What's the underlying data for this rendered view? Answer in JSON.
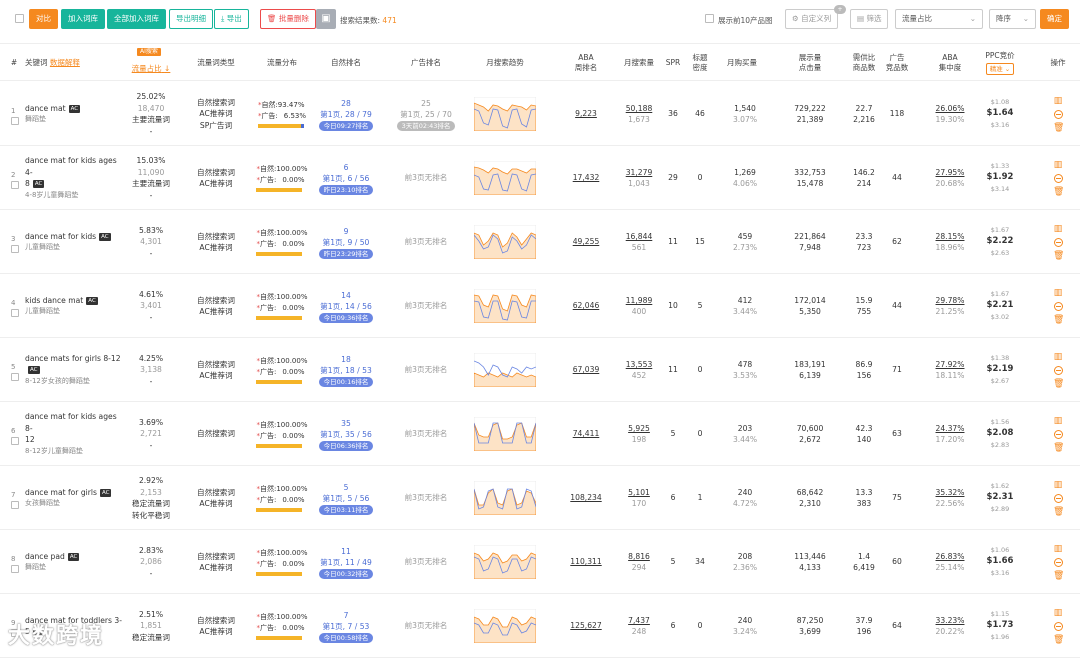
{
  "toolbar": {
    "compare": "对比",
    "add": "加入词库",
    "add_all": "全部加入词库",
    "export_detail": "导出明细",
    "export": "导出",
    "batch_delete": "批量删除",
    "result_label": "搜索结果数:",
    "result_count": "471",
    "show_top10": "展示前10产品图",
    "custom_cols": "自定义列",
    "custom_badge": "+",
    "filter": "筛选",
    "sort_field": "流量占比",
    "sort_order": "降序",
    "confirm": "确定"
  },
  "header": {
    "idx": "#",
    "keyword": "关键词",
    "translate": "数据解释",
    "share_tag": "AI搜索",
    "share": "流量占比",
    "type": "流量词类型",
    "dist": "流量分布",
    "natural": "自然排名",
    "ad": "广告排名",
    "trend": "月搜索趋势",
    "aba_l1": "ABA",
    "aba_l2": "周排名",
    "monthly": "月搜索量",
    "spr": "SPR",
    "title_l1": "标题",
    "title_l2": "密度",
    "buy": "月购买量",
    "disp_l1": "展示量",
    "disp_l2": "点击量",
    "ratio_l1": "需供比",
    "ratio_l2": "商品数",
    "adc_l1": "广告",
    "adc_l2": "竞品数",
    "conc_l1": "ABA",
    "conc_l2": "集中度",
    "ppc": "PPC竞价",
    "ppc_mode": "精准",
    "ops": "操作"
  },
  "labels": {
    "natural_prefix": "自然:",
    "ad_prefix": "广告:"
  },
  "rows": [
    {
      "idx": "1",
      "kw": "dance mat",
      "kw2": "",
      "ac": "AC",
      "cn": "舞蹈垫",
      "share": "25.02%",
      "share2": "18,470",
      "share3": "主要流量词",
      "share4": "-",
      "types": [
        "自然搜索词",
        "AC推荐词",
        "SP广告词"
      ],
      "nat_pct": "93.47%",
      "ad_pct": "6.53%",
      "ad_frac": 0.07,
      "nat_rank": "28",
      "nat_page": "第1页, 28 / 79",
      "nat_pill": "今日09:27排名",
      "ad_rank": "25",
      "ad_page": "第1页, 25 / 70",
      "ad_pill": "3天前02:43排名",
      "ad_none": "",
      "trend": [
        22,
        20,
        8,
        6,
        22,
        21,
        5,
        3,
        21,
        22,
        7,
        4,
        21,
        22
      ],
      "trend2": [
        28,
        26,
        24,
        20,
        26,
        25,
        22,
        20,
        26,
        25,
        24,
        21,
        26,
        25
      ],
      "aba": "9,223",
      "monthly": "50,188",
      "monthly2": "1,673",
      "spr": "36",
      "title": "46",
      "buy": "1,540",
      "buy2": "3.07%",
      "disp": "729,222",
      "click": "21,389",
      "ratio": "22.7",
      "goods": "2,216",
      "adc": "118",
      "conc": "26.06%",
      "conc2": "19.30%",
      "ppc_top": "$1.08",
      "ppc": "$1.64",
      "ppc_bot": "$3.16"
    },
    {
      "idx": "2",
      "kw": "dance mat for kids ages 4-",
      "kw2": "8",
      "ac": "AC",
      "cn": "4-8岁儿童舞蹈垫",
      "share": "15.03%",
      "share2": "11,090",
      "share3": "主要流量词",
      "share4": "-",
      "types": [
        "自然搜索词",
        "AC推荐词"
      ],
      "nat_pct": "100.00%",
      "ad_pct": "0.00%",
      "ad_frac": 0,
      "nat_rank": "6",
      "nat_page": "第1页, 6 / 56",
      "nat_pill": "昨日23:10排名",
      "ad_rank": "",
      "ad_page": "",
      "ad_pill": "",
      "ad_none": "前3页无排名",
      "trend": [
        20,
        18,
        6,
        5,
        20,
        21,
        5,
        4,
        21,
        20,
        6,
        4,
        20,
        21
      ],
      "trend2": [
        28,
        27,
        25,
        22,
        27,
        26,
        23,
        21,
        26,
        26,
        24,
        22,
        26,
        26
      ],
      "aba": "17,432",
      "monthly": "31,279",
      "monthly2": "1,043",
      "spr": "29",
      "title": "0",
      "buy": "1,269",
      "buy2": "4.06%",
      "disp": "332,753",
      "click": "15,478",
      "ratio": "146.2",
      "goods": "214",
      "adc": "44",
      "conc": "27.95%",
      "conc2": "20.68%",
      "ppc_top": "$1.33",
      "ppc": "$1.92",
      "ppc_bot": "$3.14"
    },
    {
      "idx": "3",
      "kw": "dance mat for kids",
      "kw2": "",
      "ac": "AC",
      "cn": "儿童舞蹈垫",
      "share": "5.83%",
      "share2": "4,301",
      "share3": "-",
      "share4": "",
      "types": [
        "自然搜索词",
        "AC推荐词"
      ],
      "nat_pct": "100.00%",
      "ad_pct": "0.00%",
      "ad_frac": 0,
      "nat_rank": "9",
      "nat_page": "第1页, 9 / 50",
      "nat_pill": "昨日23:29排名",
      "ad_rank": "",
      "ad_page": "",
      "ad_pill": "",
      "ad_none": "前3页无排名",
      "trend": [
        24,
        18,
        10,
        12,
        24,
        20,
        6,
        8,
        22,
        18,
        10,
        14,
        24,
        20
      ],
      "trend2": [
        26,
        24,
        14,
        18,
        26,
        24,
        12,
        16,
        26,
        22,
        14,
        20,
        26,
        24
      ],
      "aba": "49,255",
      "monthly": "16,844",
      "monthly2": "561",
      "spr": "11",
      "title": "15",
      "buy": "459",
      "buy2": "2.73%",
      "disp": "221,864",
      "click": "7,948",
      "ratio": "23.3",
      "goods": "723",
      "adc": "62",
      "conc": "28.15%",
      "conc2": "18.96%",
      "ppc_top": "$1.67",
      "ppc": "$2.22",
      "ppc_bot": "$2.63"
    },
    {
      "idx": "4",
      "kw": "kids dance mat",
      "kw2": "",
      "ac": "AC",
      "cn": "儿童舞蹈垫",
      "share": "4.61%",
      "share2": "3,401",
      "share3": "-",
      "share4": "",
      "types": [
        "自然搜索词",
        "AC推荐词"
      ],
      "nat_pct": "100.00%",
      "ad_pct": "0.00%",
      "ad_frac": 0,
      "nat_rank": "14",
      "nat_page": "第1页, 14 / 56",
      "nat_pill": "今日09:36排名",
      "ad_rank": "",
      "ad_page": "",
      "ad_pill": "",
      "ad_none": "前3页无排名",
      "trend": [
        22,
        21,
        6,
        5,
        22,
        22,
        4,
        3,
        22,
        21,
        6,
        5,
        22,
        22
      ],
      "trend2": [
        28,
        27,
        18,
        16,
        28,
        27,
        14,
        12,
        28,
        27,
        18,
        16,
        28,
        27
      ],
      "aba": "62,046",
      "monthly": "11,989",
      "monthly2": "400",
      "spr": "10",
      "title": "5",
      "buy": "412",
      "buy2": "3.44%",
      "disp": "172,014",
      "click": "5,350",
      "ratio": "15.9",
      "goods": "755",
      "adc": "44",
      "conc": "29.78%",
      "conc2": "21.25%",
      "ppc_top": "$1.67",
      "ppc": "$2.21",
      "ppc_bot": "$3.02"
    },
    {
      "idx": "5",
      "kw": "dance mats for girls 8-12",
      "kw2": "",
      "ac": "AC",
      "cn": "8-12岁女孩的舞蹈垫",
      "share": "4.25%",
      "share2": "3,138",
      "share3": "-",
      "share4": "",
      "types": [
        "自然搜索词",
        "AC推荐词"
      ],
      "nat_pct": "100.00%",
      "ad_pct": "0.00%",
      "ad_frac": 0,
      "nat_rank": "18",
      "nat_page": "第1页, 18 / 53",
      "nat_pill": "今日00:16排名",
      "ad_rank": "",
      "ad_page": "",
      "ad_pill": "",
      "ad_none": "前3页无排名",
      "trend": [
        26,
        24,
        20,
        12,
        22,
        20,
        12,
        10,
        20,
        18,
        14,
        20,
        18,
        20
      ],
      "trend2": [
        14,
        12,
        10,
        14,
        12,
        10,
        14,
        12,
        10,
        14,
        12,
        10,
        12,
        10
      ],
      "aba": "67,039",
      "monthly": "13,553",
      "monthly2": "452",
      "spr": "11",
      "title": "0",
      "buy": "478",
      "buy2": "3.53%",
      "disp": "183,191",
      "click": "6,139",
      "ratio": "86.9",
      "goods": "156",
      "adc": "71",
      "conc": "27.92%",
      "conc2": "18.11%",
      "ppc_top": "$1.38",
      "ppc": "$2.19",
      "ppc_bot": "$2.67"
    },
    {
      "idx": "6",
      "kw": "dance mat for kids ages 8-",
      "kw2": "12",
      "ac": "",
      "cn": "8-12岁儿童舞蹈垫",
      "share": "3.69%",
      "share2": "2,721",
      "share3": "-",
      "share4": "",
      "types": [
        "自然搜索词"
      ],
      "nat_pct": "100.00%",
      "ad_pct": "0.00%",
      "ad_frac": 0,
      "nat_rank": "35",
      "nat_page": "第1页, 35 / 56",
      "nat_pill": "今日06:36排名",
      "ad_rank": "",
      "ad_page": "",
      "ad_pill": "",
      "ad_none": "前3页无排名",
      "trend": [
        28,
        8,
        8,
        8,
        28,
        28,
        8,
        8,
        8,
        28,
        28,
        8,
        8,
        28
      ],
      "trend2": [
        28,
        16,
        14,
        14,
        26,
        28,
        12,
        12,
        14,
        26,
        28,
        14,
        14,
        28
      ],
      "aba": "74,411",
      "monthly": "5,925",
      "monthly2": "198",
      "spr": "5",
      "title": "0",
      "buy": "203",
      "buy2": "3.44%",
      "disp": "70,600",
      "click": "2,672",
      "ratio": "42.3",
      "goods": "140",
      "adc": "63",
      "conc": "24.37%",
      "conc2": "17.20%",
      "ppc_top": "$1.56",
      "ppc": "$2.08",
      "ppc_bot": "$2.83"
    },
    {
      "idx": "7",
      "kw": "dance mat for girls",
      "kw2": "",
      "ac": "AC",
      "cn": "女孩舞蹈垫",
      "share": "2.92%",
      "share2": "2,153",
      "share3": "稳定流量词",
      "share4": "转化平稳词",
      "types": [
        "自然搜索词",
        "AC推荐词"
      ],
      "nat_pct": "100.00%",
      "ad_pct": "0.00%",
      "ad_frac": 0,
      "nat_rank": "5",
      "nat_page": "第1页, 5 / 56",
      "nat_pill": "今日03:11排名",
      "ad_rank": "",
      "ad_page": "",
      "ad_pill": "",
      "ad_none": "前3页无排名",
      "trend": [
        26,
        6,
        8,
        24,
        26,
        8,
        6,
        26,
        26,
        6,
        8,
        26,
        24,
        8
      ],
      "trend2": [
        26,
        10,
        10,
        22,
        26,
        12,
        10,
        24,
        26,
        10,
        12,
        24,
        22,
        12
      ],
      "aba": "108,234",
      "monthly": "5,101",
      "monthly2": "170",
      "spr": "6",
      "title": "1",
      "buy": "240",
      "buy2": "4.72%",
      "disp": "68,642",
      "click": "2,310",
      "ratio": "13.3",
      "goods": "383",
      "adc": "75",
      "conc": "35.32%",
      "conc2": "22.56%",
      "ppc_top": "$1.62",
      "ppc": "$2.31",
      "ppc_bot": "$2.89"
    },
    {
      "idx": "8",
      "kw": "dance pad",
      "kw2": "",
      "ac": "AC",
      "cn": "舞蹈垫",
      "share": "2.83%",
      "share2": "2,086",
      "share3": "-",
      "share4": "",
      "types": [
        "自然搜索词",
        "AC推荐词"
      ],
      "nat_pct": "100.00%",
      "ad_pct": "0.00%",
      "ad_frac": 0,
      "nat_rank": "11",
      "nat_page": "第1页, 11 / 49",
      "nat_pill": "今日00:32排名",
      "ad_rank": "",
      "ad_page": "",
      "ad_pill": "",
      "ad_none": "前3页无排名",
      "trend": [
        22,
        20,
        8,
        10,
        22,
        20,
        6,
        8,
        20,
        20,
        8,
        10,
        22,
        20
      ],
      "trend2": [
        26,
        24,
        18,
        20,
        26,
        24,
        16,
        18,
        24,
        24,
        18,
        20,
        26,
        24
      ],
      "aba": "110,311",
      "monthly": "8,816",
      "monthly2": "294",
      "spr": "5",
      "title": "34",
      "buy": "208",
      "buy2": "2.36%",
      "disp": "113,446",
      "click": "4,133",
      "ratio": "1.4",
      "goods": "6,419",
      "adc": "60",
      "conc": "26.83%",
      "conc2": "25.14%",
      "ppc_top": "$1.06",
      "ppc": "$1.66",
      "ppc_bot": "$3.16"
    },
    {
      "idx": "9",
      "kw": "dance mat for toddlers 3-5",
      "kw2": "",
      "ac": "AC",
      "cn": "",
      "share": "2.51%",
      "share2": "1,851",
      "share3": "稳定流量词",
      "share4": "",
      "types": [
        "自然搜索词",
        "AC推荐词"
      ],
      "nat_pct": "100.00%",
      "ad_pct": "0.00%",
      "ad_frac": 0,
      "nat_rank": "7",
      "nat_page": "第1页, 7 / 53",
      "nat_pill": "今日00:58排名",
      "ad_rank": "",
      "ad_page": "",
      "ad_pill": "",
      "ad_none": "前3页无排名",
      "trend": [
        20,
        18,
        10,
        10,
        20,
        18,
        8,
        8,
        20,
        18,
        10,
        12,
        20,
        18
      ],
      "trend2": [
        26,
        24,
        18,
        18,
        26,
        24,
        16,
        16,
        26,
        24,
        18,
        20,
        26,
        24
      ],
      "aba": "125,627",
      "monthly": "7,437",
      "monthly2": "248",
      "spr": "6",
      "title": "0",
      "buy": "240",
      "buy2": "3.24%",
      "disp": "87,250",
      "click": "3,699",
      "ratio": "37.9",
      "goods": "196",
      "adc": "64",
      "conc": "33.23%",
      "conc2": "20.22%",
      "ppc_top": "$1.15",
      "ppc": "$1.73",
      "ppc_bot": "$1.96"
    }
  ],
  "watermark": "大数跨境",
  "colors": {
    "orange": "#f5891f",
    "teal": "#17b59b",
    "blue": "#4a6cd4",
    "red": "#ec4b4b",
    "bar": "#f5b428"
  }
}
